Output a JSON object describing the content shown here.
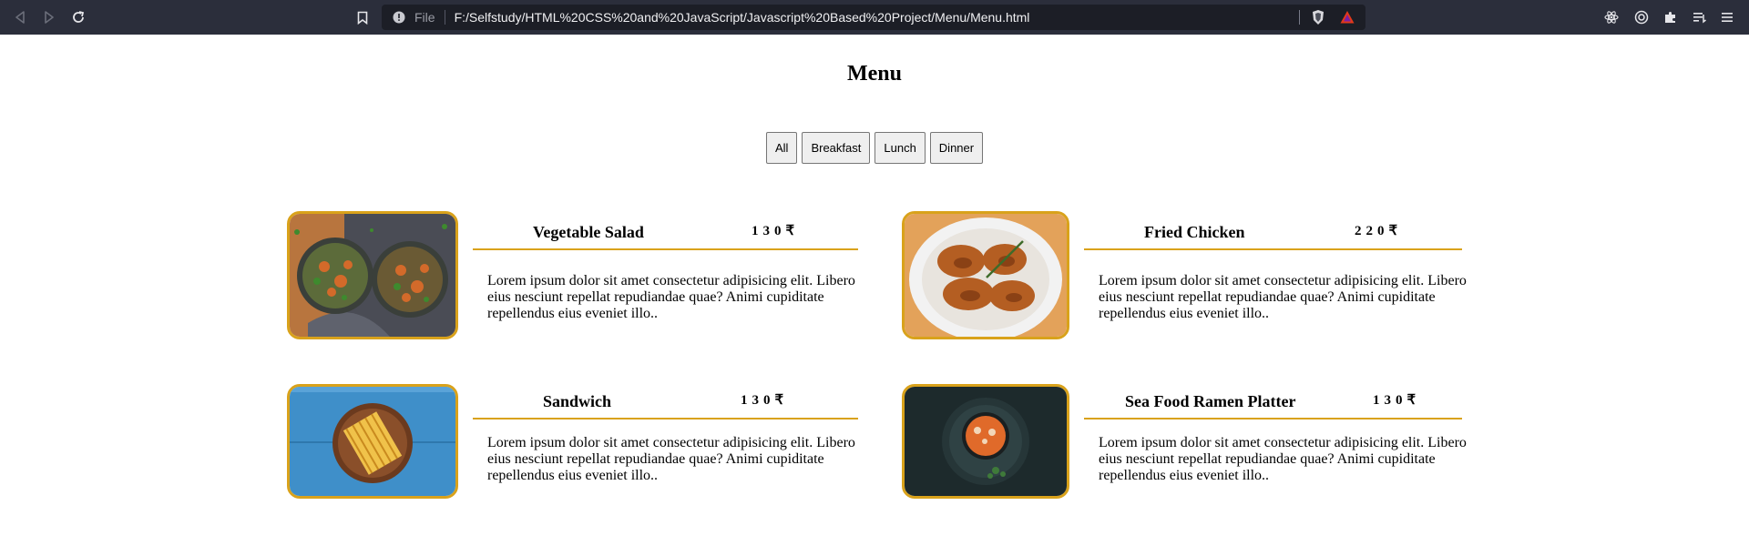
{
  "browser": {
    "address_prefix": "File",
    "url": "F:/Selfstudy/HTML%20CSS%20and%20JavaScript/Javascript%20Based%20Project/Menu/Menu.html"
  },
  "page": {
    "title": "Menu",
    "filters": [
      "All",
      "Breakfast",
      "Lunch",
      "Dinner"
    ]
  },
  "menu_items": [
    {
      "name": "Vegetable Salad",
      "price": "130₹",
      "description": "Lorem ipsum dolor sit amet consectetur adipisicing elit. Libero eius nesciunt repellat repudiandae quae? Animi cupiditate repellendus eius eveniet illo..",
      "image": "vegetable-salad-photo"
    },
    {
      "name": "Fried Chicken",
      "price": "220₹",
      "description": "Lorem ipsum dolor sit amet consectetur adipisicing elit. Libero eius nesciunt repellat repudiandae quae? Animi cupiditate repellendus eius eveniet illo..",
      "image": "fried-chicken-photo"
    },
    {
      "name": "Sandwich",
      "price": "130₹",
      "description": "Lorem ipsum dolor sit amet consectetur adipisicing elit. Libero eius nesciunt repellat repudiandae quae? Animi cupiditate repellendus eius eveniet illo..",
      "image": "sandwich-photo"
    },
    {
      "name": "Sea Food Ramen Platter",
      "price": "130₹",
      "description": "Lorem ipsum dolor sit amet consectetur adipisicing elit. Libero eius nesciunt repellat repudiandae quae? Animi cupiditate repellendus eius eveniet illo..",
      "image": "seafood-ramen-photo"
    }
  ],
  "colors": {
    "accent": "#d9a21b",
    "chrome_bg": "#2b2e3b",
    "urlbar_bg": "#1c1e26"
  }
}
